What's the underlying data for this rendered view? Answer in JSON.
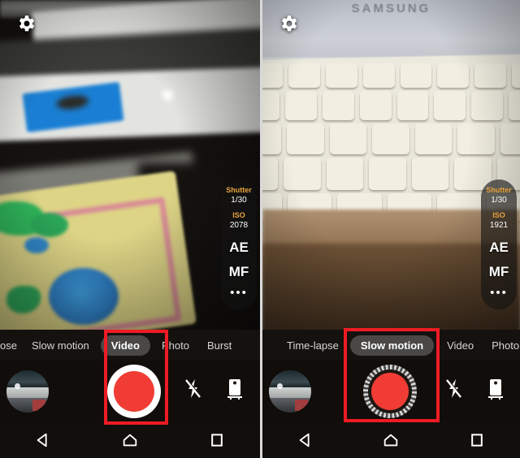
{
  "panels": [
    {
      "id": "left",
      "scene_description": "Dim indoor scene with white paper, blue tape and floral fabric",
      "gear_icon": "gear-icon",
      "rail": {
        "shutter_label": "Shutter",
        "shutter_value": "1/30",
        "iso_label": "ISO",
        "iso_value": "2078",
        "ae_label": "AE",
        "mf_label": "MF",
        "more_label": "•••"
      },
      "modes": [
        {
          "label": "ose",
          "selected": false
        },
        {
          "label": "Slow motion",
          "selected": false
        },
        {
          "label": "Video",
          "selected": true
        },
        {
          "label": "Photo",
          "selected": false
        },
        {
          "label": "Burst",
          "selected": false
        }
      ],
      "shutter": {
        "thumbnail_name": "gallery-thumbnail",
        "record_style": "solid-ring",
        "flash_label": "flash-off-icon",
        "camswap_label": "camera-switch-icon"
      },
      "nav": {
        "back": "back-icon",
        "home": "home-icon",
        "recents": "recents-icon"
      }
    },
    {
      "id": "right",
      "scene_description": "White SAMSUNG laptop keyboard on a wooden desk",
      "brand_text": "SAMSUNG",
      "gear_icon": "gear-icon",
      "rail": {
        "shutter_label": "Shutter",
        "shutter_value": "1/30",
        "iso_label": "ISO",
        "iso_value": "1921",
        "ae_label": "AE",
        "mf_label": "MF",
        "more_label": "•••"
      },
      "modes": [
        {
          "label": "Time-lapse",
          "selected": false
        },
        {
          "label": "Slow motion",
          "selected": true
        },
        {
          "label": "Video",
          "selected": false
        },
        {
          "label": "Photo",
          "selected": false
        }
      ],
      "shutter": {
        "thumbnail_name": "gallery-thumbnail",
        "record_style": "segmented-ring",
        "flash_label": "flash-off-icon",
        "camswap_label": "camera-switch-icon"
      },
      "nav": {
        "back": "back-icon",
        "home": "home-icon",
        "recents": "recents-icon"
      }
    }
  ],
  "colors": {
    "annotation": "#ef1b24",
    "accent_label": "#e8a33d",
    "record_red": "#f03c34",
    "rail_bg": "rgba(20,20,20,0.62)"
  }
}
